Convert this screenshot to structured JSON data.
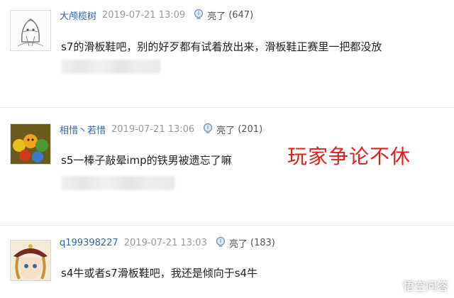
{
  "comments": [
    {
      "username": "大颅榄树",
      "timestamp": "2019-07-21 13:09",
      "like_label": "亮了",
      "like_count": "(647)",
      "text": "s7的滑板鞋吧，别的好歹都有试着放出来，滑板鞋正赛里一把都没放"
    },
    {
      "username": "相惜丶若惜",
      "timestamp": "2019-07-21 13:06",
      "like_label": "亮了",
      "like_count": "(201)",
      "text": "s5一棒子敲晕imp的铁男被遗忘了嘛"
    },
    {
      "username": "q199398227",
      "timestamp": "2019-07-21 13:03",
      "like_label": "亮了",
      "like_count": "(183)",
      "text": "s4牛或者s7滑板鞋吧，我还是倾向于s4牛"
    }
  ],
  "overlay_caption": "玩家争论不休",
  "watermark": {
    "text": "悟空问答",
    "icon": "wukong-logo-icon"
  },
  "colors": {
    "username": "#3465a4",
    "timestamp": "#999999",
    "overlay": "#e02020",
    "divider": "#e6e6e6"
  }
}
